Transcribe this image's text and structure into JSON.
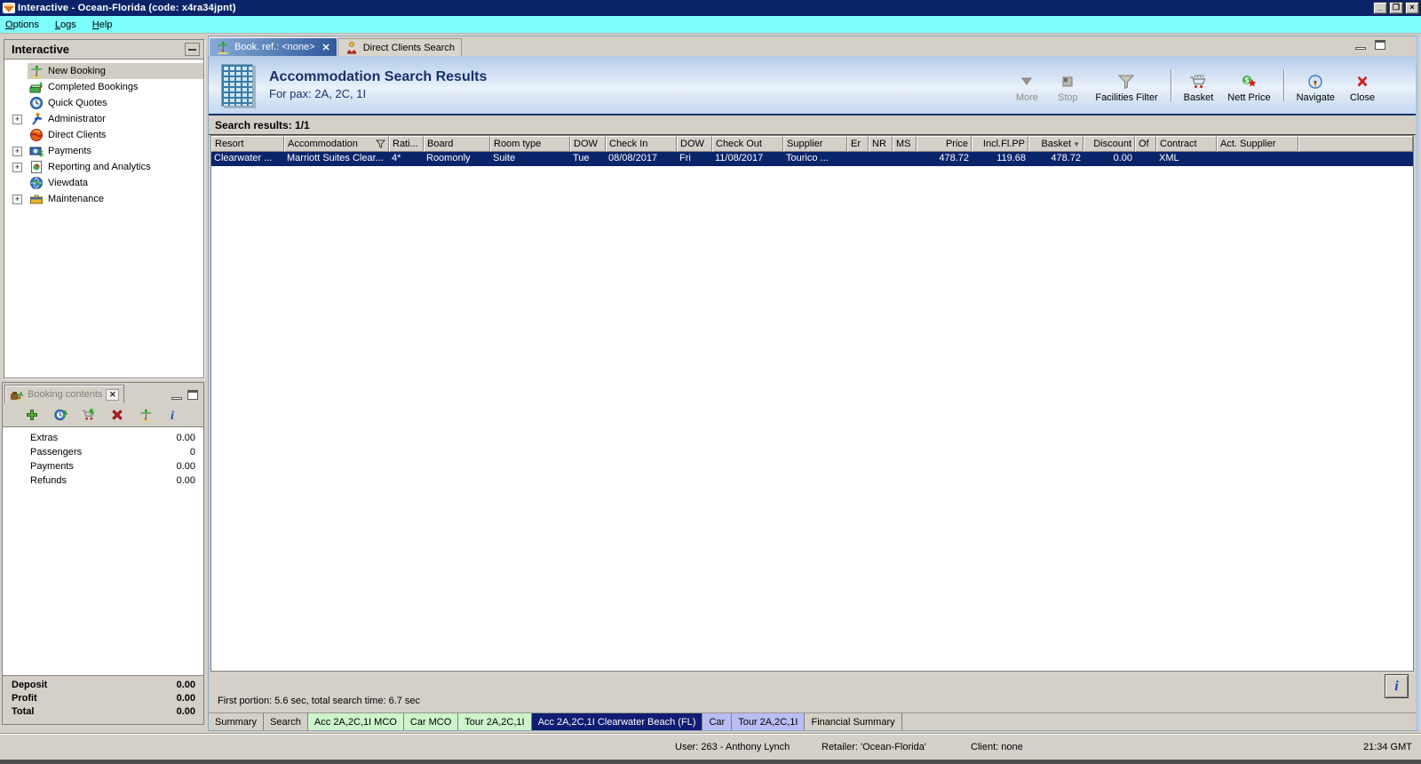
{
  "window": {
    "title": "Interactive - Ocean-Florida (code: x4ra34jpnt)",
    "controls": [
      "minimize",
      "restore",
      "close"
    ]
  },
  "menu": {
    "items": [
      "Options",
      "Logs",
      "Help"
    ]
  },
  "sidebar": {
    "title": "Interactive",
    "items": [
      {
        "label": "New Booking",
        "icon": "palm-tree-icon",
        "expandable": false,
        "selected": true
      },
      {
        "label": "Completed Bookings",
        "icon": "money-palm-icon",
        "expandable": false,
        "selected": false
      },
      {
        "label": "Quick Quotes",
        "icon": "clock-globe-icon",
        "expandable": false,
        "selected": false
      },
      {
        "label": "Administrator",
        "icon": "person-run-icon",
        "expandable": true,
        "selected": false
      },
      {
        "label": "Direct Clients",
        "icon": "globe-red-icon",
        "expandable": false,
        "selected": false
      },
      {
        "label": "Payments",
        "icon": "money-icon",
        "expandable": true,
        "selected": false
      },
      {
        "label": "Reporting and Analytics",
        "icon": "report-icon",
        "expandable": true,
        "selected": false
      },
      {
        "label": "Viewdata",
        "icon": "globe-blue-icon",
        "expandable": false,
        "selected": false
      },
      {
        "label": "Maintenance",
        "icon": "toolbox-icon",
        "expandable": true,
        "selected": false
      }
    ]
  },
  "booking_contents": {
    "tab_label": "Booking contents",
    "toolbar_icons": [
      "add-icon",
      "refresh-globe-icon",
      "cart-add-icon",
      "delete-icon",
      "palm-tree-icon",
      "info-icon"
    ],
    "rows": [
      {
        "label": "Extras",
        "value": "0.00"
      },
      {
        "label": "Passengers",
        "value": "0"
      },
      {
        "label": "Payments",
        "value": "0.00"
      },
      {
        "label": "Refunds",
        "value": "0.00"
      }
    ],
    "totals": [
      {
        "label": "Deposit",
        "value": "0.00"
      },
      {
        "label": "Profit",
        "value": "0.00"
      },
      {
        "label": "Total",
        "value": "0.00"
      }
    ]
  },
  "main": {
    "tabs": [
      {
        "label": "Book. ref.: <none>",
        "icon": "palm-tree-icon",
        "closable": true,
        "active": true
      },
      {
        "label": "Direct Clients Search",
        "icon": "person-icon",
        "closable": false,
        "active": false
      }
    ],
    "header": {
      "icon": "building-icon",
      "title": "Accommodation Search Results",
      "subtitle": "For pax: 2A, 2C, 1I"
    },
    "toolbar": [
      {
        "label": "More",
        "icon": "more-arrow-icon",
        "disabled": true,
        "sep_after": false
      },
      {
        "label": "Stop",
        "icon": "stop-icon",
        "disabled": true,
        "sep_after": false
      },
      {
        "label": "Facilities Filter",
        "icon": "funnel-icon",
        "disabled": false,
        "sep_after": true
      },
      {
        "label": "Basket",
        "icon": "basket-icon",
        "disabled": false,
        "sep_after": false
      },
      {
        "label": "Nett Price",
        "icon": "nett-price-icon",
        "disabled": false,
        "sep_after": true
      },
      {
        "label": "Navigate",
        "icon": "compass-icon",
        "disabled": false,
        "sep_after": false
      },
      {
        "label": "Close",
        "icon": "close-x-icon",
        "disabled": false,
        "sep_after": false
      }
    ],
    "results_label": "Search results: 1/1",
    "table": {
      "columns": [
        "Resort",
        "Accommodation",
        "Rati...",
        "Board",
        "Room type",
        "DOW",
        "Check In",
        "DOW",
        "Check Out",
        "Supplier",
        "Er",
        "NR",
        "MS",
        "Price",
        "Incl.Fl.PP",
        "Basket",
        "Discount",
        "Of",
        "Contract",
        "Act. Supplier"
      ],
      "filter_column": "Accommodation",
      "sort_column": "Basket",
      "rows": [
        [
          "Clearwater ...",
          "Marriott Suites Clear...",
          "4*",
          "Roomonly",
          "Suite",
          "Tue",
          "08/08/2017",
          "Fri",
          "11/08/2017",
          "Tourico ...",
          "",
          "",
          "",
          "478.72",
          "119.68",
          "478.72",
          "0.00",
          "",
          "XML",
          ""
        ]
      ]
    },
    "status_text": "First portion: 5.6 sec, total search time: 6.7 sec",
    "info_button": "i",
    "bottom_tabs": [
      {
        "label": "Summary",
        "type": "plain"
      },
      {
        "label": "Search",
        "type": "plain"
      },
      {
        "label": "Acc 2A,2C,1I MCO",
        "type": "green"
      },
      {
        "label": "Car MCO",
        "type": "green"
      },
      {
        "label": "Tour 2A,2C,1I",
        "type": "green"
      },
      {
        "label": "Acc 2A,2C,1I Clearwater Beach (FL)",
        "type": "active"
      },
      {
        "label": "Car",
        "type": "purple"
      },
      {
        "label": "Tour 2A,2C,1I",
        "type": "purple"
      },
      {
        "label": "Financial Summary",
        "type": "plain"
      }
    ]
  },
  "statusbar": {
    "user": "User: 263 - Anthony Lynch",
    "retailer": "Retailer: 'Ocean-Florida'",
    "client": "Client: none",
    "time": "21:34 GMT"
  },
  "colors": {
    "titlebar": "#0a246a",
    "menubar": "#7dfdfe",
    "chrome": "#d4d0c8",
    "selected_row": "#0a246a",
    "header_text": "#17316c",
    "tab_green": "#cdf4ca",
    "tab_purple": "#b9bdf3",
    "tab_active": "#101d72"
  }
}
